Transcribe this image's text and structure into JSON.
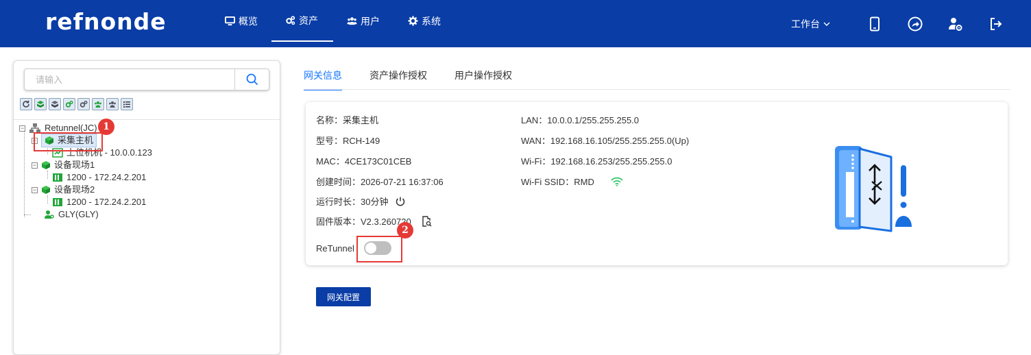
{
  "brand": {
    "logo_text": "refnonde"
  },
  "nav": {
    "items": [
      {
        "label": "概览",
        "icon": "monitor-icon"
      },
      {
        "label": "资产",
        "icon": "cogs-icon"
      },
      {
        "label": "用户",
        "icon": "users-icon"
      },
      {
        "label": "系统",
        "icon": "gear-icon"
      }
    ],
    "active": "资产",
    "workbench": "工作台",
    "right_icons": [
      "mobile-icon",
      "share-icon",
      "user-settings-icon",
      "logout-icon"
    ]
  },
  "sidebar": {
    "search_placeholder": "请输入",
    "toolbar_icons": [
      "refresh-icon",
      "group-green-icon",
      "group-gray-icon",
      "cogs-green-icon",
      "cogs-gray-icon",
      "users-green-icon",
      "users-gray-icon",
      "list-icon"
    ],
    "tree": {
      "root": "Retunnel(JC)",
      "nodes": [
        {
          "label": "采集主机",
          "selected": true
        },
        {
          "label": "上位机机 - 10.0.0.123"
        },
        {
          "label": "设备现场1"
        },
        {
          "label": "1200 - 172.24.2.201"
        },
        {
          "label": "设备现场2"
        },
        {
          "label": "1200 - 172.24.2.201"
        },
        {
          "label": "GLY(GLY)"
        }
      ]
    }
  },
  "tabs": [
    "网关信息",
    "资产操作授权",
    "用户操作授权"
  ],
  "gateway": {
    "name": "名称：采集主机",
    "model": "型号：RCH-149",
    "mac": "MAC：4CE173C01CEB",
    "created": "创建时间：2026-07-21 16:37:06",
    "uptime": "运行时长：30分钟",
    "firmware": "固件版本：V2.3.260720",
    "lan": "LAN：10.0.0.1/255.255.255.0",
    "wan": "WAN：192.168.16.105/255.255.255.0(Up)",
    "wifi": "Wi-Fi：192.168.16.253/255.255.255.0",
    "wifi_ssid": "Wi-Fi SSID：RMD",
    "retunnel_label": "ReTunnel",
    "retunnel_enabled": false
  },
  "buttons": {
    "config": "网关配置"
  },
  "callouts": [
    "1",
    "2"
  ],
  "colors": {
    "brand": "#0a3da6",
    "accent": "#1677ff",
    "green": "#22a63a",
    "callout": "#e53935"
  }
}
